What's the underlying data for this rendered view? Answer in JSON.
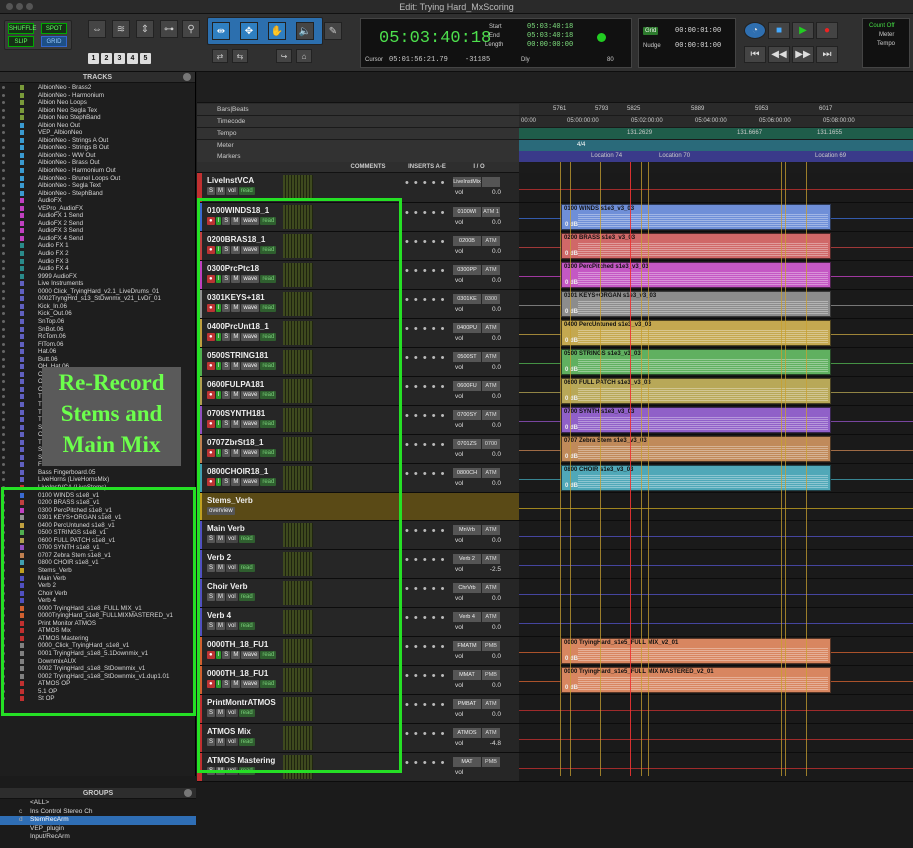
{
  "window": {
    "title": "Edit: Trying Hard_MxScoring"
  },
  "toolbar": {
    "modes": [
      "SHUFFLE",
      "SPOT",
      "SLIP",
      "GRID"
    ],
    "zoom_presets": [
      "1",
      "2",
      "3",
      "4",
      "5"
    ],
    "counter": {
      "main": "05:03:40:18",
      "start_label": "Start",
      "end_label": "End",
      "length_label": "Length",
      "start": "05:03:40:18",
      "end": "05:03:40:18",
      "length": "00:00:00:00",
      "cursor_label": "Cursor",
      "cursor": "05:01:56:21.79",
      "sample": "-31185",
      "dly": "Dly",
      "count": "80"
    },
    "grid": {
      "grid_label": "Grid",
      "grid_value": "00:00:01:00",
      "nudge_label": "Nudge",
      "nudge_value": "00:00:01:00"
    },
    "countoff": {
      "line1": "Count Off",
      "line2": "Meter",
      "line3": "Tempo"
    }
  },
  "tracks_panel": {
    "title": "TRACKS",
    "items": [
      {
        "name": "AlbionNeo - Brass2",
        "color": "#7a9a3a"
      },
      {
        "name": "AlbionNeo - Harmonium",
        "color": "#7a9a3a"
      },
      {
        "name": "Albion Neo Loops",
        "color": "#7a9a3a"
      },
      {
        "name": "Albion Neo Segla Tex",
        "color": "#7a9a3a"
      },
      {
        "name": "Albion Neo StephBand",
        "color": "#7a9a3a"
      },
      {
        "name": "Albion Neo Out",
        "color": "#3a9ad0"
      },
      {
        "name": "VEP_AlbionNeo",
        "color": "#3a9ad0"
      },
      {
        "name": "AlbionNeo - Strings A Out",
        "color": "#3a9ad0"
      },
      {
        "name": "AlbionNeo - Strings B Out",
        "color": "#3a9ad0"
      },
      {
        "name": "AlbionNeo - WW Out",
        "color": "#3a9ad0"
      },
      {
        "name": "AlbionNeo - Brass Out",
        "color": "#3a9ad0"
      },
      {
        "name": "AlbionNeo - Harmonium Out",
        "color": "#3a9ad0"
      },
      {
        "name": "AlbionNeo - Brunel Loops Out",
        "color": "#3a9ad0"
      },
      {
        "name": "AlbionNeo - Segla Text",
        "color": "#3a9ad0"
      },
      {
        "name": "AlbionNeo - StephBand",
        "color": "#3a9ad0"
      },
      {
        "name": "AudioFX",
        "color": "#c040c0"
      },
      {
        "name": "VEPro_AudioFX",
        "color": "#c040c0"
      },
      {
        "name": "AudioFX 1 Send",
        "color": "#c040c0"
      },
      {
        "name": "AudioFX 2 Send",
        "color": "#c040c0"
      },
      {
        "name": "AudioFX 3 Send",
        "color": "#c040c0"
      },
      {
        "name": "AudioFX 4 Send",
        "color": "#c040c0"
      },
      {
        "name": "Audio FX 1",
        "color": "#2a8a8a"
      },
      {
        "name": "Audio FX 2",
        "color": "#2a8a8a"
      },
      {
        "name": "Audio FX 3",
        "color": "#2a8a8a"
      },
      {
        "name": "Audio FX 4",
        "color": "#2a8a8a"
      },
      {
        "name": "9999 AudioFX",
        "color": "#2a8a8a"
      },
      {
        "name": "Live Instruments",
        "color": "#6060c0"
      },
      {
        "name": "0000 Click_TryingHard_v2.1_LiveDrums_01",
        "color": "#6060c0"
      },
      {
        "name": "0002TryngHrd_s13_StDwnmx_v21_LvDr_01",
        "color": "#6060c0"
      },
      {
        "name": "Kick_In.06",
        "color": "#6060c0"
      },
      {
        "name": "Kick_Out.06",
        "color": "#6060c0"
      },
      {
        "name": "SnTop.06",
        "color": "#6060c0"
      },
      {
        "name": "SnBot.06",
        "color": "#6060c0"
      },
      {
        "name": "RcTom.06",
        "color": "#6060c0"
      },
      {
        "name": "FlTom.06",
        "color": "#6060c0"
      },
      {
        "name": "Hat.06",
        "color": "#6060c0"
      },
      {
        "name": "Butt.06",
        "color": "#6060c0"
      },
      {
        "name": "OH_Hat.06",
        "color": "#6060c0"
      },
      {
        "name": "C",
        "color": "#6060c0"
      },
      {
        "name": "O",
        "color": "#6060c0"
      },
      {
        "name": "C",
        "color": "#6060c0"
      },
      {
        "name": "T",
        "color": "#6060c0"
      },
      {
        "name": "T",
        "color": "#6060c0"
      },
      {
        "name": "T",
        "color": "#6060c0"
      },
      {
        "name": "T",
        "color": "#6060c0"
      },
      {
        "name": "S",
        "color": "#6060c0"
      },
      {
        "name": "C",
        "color": "#6060c0"
      },
      {
        "name": "T",
        "color": "#6060c0"
      },
      {
        "name": "S",
        "color": "#6060c0"
      },
      {
        "name": "S",
        "color": "#6060c0"
      },
      {
        "name": "F",
        "color": "#6060c0"
      },
      {
        "name": "Bass Fingerboard.05",
        "color": "#6060c0"
      },
      {
        "name": "LiveHorns (LiveHornsMix)",
        "color": "#6060c0"
      },
      {
        "name": "LiveInstVCA (LiveStems)",
        "color": "#c03030"
      },
      {
        "name": "0100 WINDS s1e8_v1",
        "color": "#3a6ad0"
      },
      {
        "name": "0200 BRASS s1e8_v1",
        "color": "#c04040"
      },
      {
        "name": "0300 PercPitched s1e8_v1",
        "color": "#c040c0"
      },
      {
        "name": "0301 KEYS+ORGAN s1e8_v1",
        "color": "#909090"
      },
      {
        "name": "0400 PercUntuned s1e8_v1",
        "color": "#c0a040"
      },
      {
        "name": "0500 STRINGS s1e8_v1",
        "color": "#50b050"
      },
      {
        "name": "0600 FULL PATCH s1e8_v1",
        "color": "#b0a050"
      },
      {
        "name": "0700 SYNTH s1e8_v1",
        "color": "#9050c0"
      },
      {
        "name": "0707 Zebra Stem s1e8_v1",
        "color": "#c08050"
      },
      {
        "name": "0800 CHOIR s1e8_v1",
        "color": "#40a0b0"
      },
      {
        "name": "Stems_Verb",
        "color": "#c0a020"
      },
      {
        "name": "Main Verb",
        "color": "#5050c0"
      },
      {
        "name": "Verb 2",
        "color": "#5050c0"
      },
      {
        "name": "Choir Verb",
        "color": "#5050c0"
      },
      {
        "name": "Verb 4",
        "color": "#5050c0"
      },
      {
        "name": "0000 TryingHard_s1e8_FULL MIX_v1",
        "color": "#d06030"
      },
      {
        "name": "0000TryingHard_s1e8_FULLMIXMASTERED_v1",
        "color": "#d06030"
      },
      {
        "name": "Print Monitor ATMOS",
        "color": "#c03030"
      },
      {
        "name": "ATMOS Mix",
        "color": "#c03030"
      },
      {
        "name": "ATMOS Mastering",
        "color": "#c03030"
      },
      {
        "name": "0000_Click_TryingHard_s1e8_v1",
        "color": "#808080"
      },
      {
        "name": "0001 TryingHard_s1e8_5.1Downmix_v1",
        "color": "#808080"
      },
      {
        "name": "DownmixAUX",
        "color": "#808080"
      },
      {
        "name": "0002 TryingHard_s1e8_StDownmix_v1",
        "color": "#808080"
      },
      {
        "name": "0002 TryingHard_s1e8_StDownmix_v1.dup1.01",
        "color": "#808080"
      },
      {
        "name": "ATMOS OP",
        "color": "#c03030"
      },
      {
        "name": "5.1 OP",
        "color": "#c03030"
      },
      {
        "name": "St OP",
        "color": "#c03030"
      }
    ]
  },
  "annotation": {
    "line1": "Re-Record",
    "line2": "Stems and",
    "line3": "Main Mix"
  },
  "groups_panel": {
    "title": "GROUPS",
    "items": [
      {
        "key": "",
        "name": "<ALL>"
      },
      {
        "key": "c",
        "name": "Ins Control Stereo Ch"
      },
      {
        "key": "d",
        "name": "StemRecArm"
      },
      {
        "key": "",
        "name": "VEP_plugin"
      },
      {
        "key": "",
        "name": "Input/RecArm"
      }
    ]
  },
  "rulers": {
    "bars_beats": "Bars|Beats",
    "timecode": "Timecode",
    "tempo": "Tempo",
    "meter": "Meter",
    "markers": "Markers",
    "bar_ticks": [
      "5761",
      "5793",
      "5825",
      "5889",
      "5953",
      "6017"
    ],
    "tc_ticks": [
      "00:00",
      "05:00:00:00",
      "05:02:00:00",
      "05:04:00:00",
      "05:06:00:00",
      "05:08:00:00"
    ],
    "tempo_vals": [
      "131.2629",
      "131.6667",
      "131.1655"
    ],
    "meter_val": "4/4",
    "marker_names": [
      "Location 74",
      "Location 70",
      "Location 69"
    ]
  },
  "columns": {
    "comments": "COMMENTS",
    "inserts": "INSERTS A-E",
    "io": "I / O"
  },
  "edit_tracks": [
    {
      "name": "LiveInstVCA",
      "type": "vca",
      "io": "LiveInstMix",
      "io2": "",
      "vol": "0.0",
      "color": "#c03030",
      "clip": null
    },
    {
      "name": "0100WINDS18_1",
      "io": "0100WI",
      "io2": "ATM 1",
      "vol": "0.0",
      "color": "#3a6ad0",
      "clip": {
        "title": "0100 WINDS s1e3_v3_03",
        "db": "0 dB",
        "color": "#6f8fd8"
      }
    },
    {
      "name": "0200BRAS18_1",
      "io": "0200B",
      "io2": "ATM",
      "vol": "0.0",
      "color": "#c04040",
      "clip": {
        "title": "0200 BRASS s1e3_v3_03",
        "db": "0 dB",
        "color": "#d06868"
      }
    },
    {
      "name": "0300PrcPtc18",
      "io": "0300PP",
      "io2": "ATM",
      "vol": "0.0",
      "color": "#c040c0",
      "clip": {
        "title": "0300 PercPitched s1e3_v3_03",
        "db": "0 dB",
        "color": "#c458c4"
      }
    },
    {
      "name": "0301KEYS+181",
      "io": "0301KE",
      "io2": "0300",
      "vol": "0.0",
      "color": "#909090",
      "clip": {
        "title": "0301 KEYS+ORGAN s1e3_v3_03",
        "db": "0 dB",
        "color": "#8c8c8c"
      }
    },
    {
      "name": "0400PrcUnt18_1",
      "io": "0400PU",
      "io2": "ATM",
      "vol": "0.0",
      "color": "#c0a040",
      "clip": {
        "title": "0400 PercUntuned s1e3_v3_03",
        "db": "0 dB",
        "color": "#c4a850"
      }
    },
    {
      "name": "0500STRING181",
      "io": "0500ST",
      "io2": "ATM",
      "vol": "0.0",
      "color": "#50b050",
      "clip": {
        "title": "0500 STRINGS s1e3_v3_03",
        "db": "0 dB",
        "color": "#60b060"
      }
    },
    {
      "name": "0600FULPA181",
      "io": "0600FU",
      "io2": "ATM",
      "vol": "0.0",
      "color": "#b0a050",
      "clip": {
        "title": "0600 FULL PATCH s1e3_v3_03",
        "db": "0 dB",
        "color": "#b8a858"
      }
    },
    {
      "name": "0700SYNTH181",
      "io": "0700SY",
      "io2": "ATM",
      "vol": "0.0",
      "color": "#9050c0",
      "clip": {
        "title": "0700 SYNTH s1e3_v3_03",
        "db": "0 dB",
        "color": "#9060c8"
      }
    },
    {
      "name": "0707ZbrSt18_1",
      "io": "0701ZS",
      "io2": "0700",
      "vol": "0.0",
      "color": "#c08050",
      "clip": {
        "title": "0707 Zebra Stem s1e3_v3_03",
        "db": "0 dB",
        "color": "#c08a5a"
      }
    },
    {
      "name": "0800CHOIR18_1",
      "io": "0800CH",
      "io2": "ATM",
      "vol": "0.0",
      "color": "#40a0b0",
      "clip": {
        "title": "0800 CHOIR s1e3_v3_03",
        "db": "0 dB",
        "color": "#50a8b8"
      }
    },
    {
      "name": "Stems_Verb",
      "type": "folder",
      "io": "",
      "io2": "",
      "vol": "",
      "color": "#c0a020",
      "clip": null,
      "sub": "overview"
    },
    {
      "name": "Main Verb",
      "io": "MnVrb",
      "io2": "ATM",
      "vol": "0.0",
      "color": "#5050c0",
      "clip": null
    },
    {
      "name": "Verb 2",
      "io": "Verb 2",
      "io2": "ATM",
      "vol": "-2.5",
      "color": "#5050c0",
      "clip": null
    },
    {
      "name": "Choir Verb",
      "io": "ChrVrb",
      "io2": "ATM",
      "vol": "0.0",
      "color": "#5050c0",
      "clip": null
    },
    {
      "name": "Verb 4",
      "io": "Verb 4",
      "io2": "ATM",
      "vol": "0.0",
      "color": "#5050c0",
      "clip": null
    },
    {
      "name": "0000TH_18_FU1",
      "io": "FMATM",
      "io2": "PMB",
      "vol": "0.0",
      "color": "#d06030",
      "clip": {
        "title": "0000 TryingHard_s1e5_FULL MIX_v2_01",
        "db": "0 dB",
        "color": "#d88660"
      }
    },
    {
      "name": "0000TH_18_FU1",
      "io": "MMAT",
      "io2": "PMB",
      "vol": "0.0",
      "color": "#d06030",
      "clip": {
        "title": "0000 TryingHard_s1e5_FULL MIX MASTERED_v2_01",
        "db": "0 dB",
        "color": "#d88660"
      }
    },
    {
      "name": "PrintMontrATMOS",
      "io": "PMBAT",
      "io2": "ATM",
      "vol": "0.0",
      "color": "#c03030",
      "clip": null
    },
    {
      "name": "ATMOS Mix",
      "io": "ATMOS",
      "io2": "ATM",
      "vol": "-4.8",
      "color": "#c03030",
      "clip": null
    },
    {
      "name": "ATMOS Mastering",
      "io": "MAT",
      "io2": "PMB",
      "vol": "",
      "color": "#c03030",
      "clip": null
    }
  ],
  "labels": {
    "vol": "vol",
    "wave": "wave",
    "read": "read"
  }
}
